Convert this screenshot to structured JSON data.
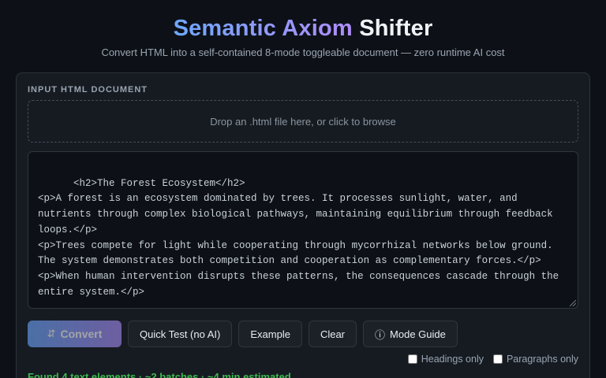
{
  "header": {
    "title_part1": "Semantic Axiom",
    "title_part2": "Shifter",
    "subtitle": "Convert HTML into a self-contained 8-mode toggleable document — zero runtime AI cost"
  },
  "input": {
    "section_label": "INPUT HTML DOCUMENT",
    "dropzone_text": "Drop an .html file here, or click to browse",
    "html_value": "<h2>The Forest Ecosystem</h2>\n<p>A forest is an ecosystem dominated by trees. It processes sunlight, water, and nutrients through complex biological pathways, maintaining equilibrium through feedback loops.</p>\n<p>Trees compete for light while cooperating through mycorrhizal networks below ground. The system demonstrates both competition and cooperation as complementary forces.</p>\n<p>When human intervention disrupts these patterns, the consequences cascade through the entire system.</p>"
  },
  "toolbar": {
    "convert_icon": "⇵",
    "convert_label": "Convert",
    "quick_test_label": "Quick Test (no AI)",
    "example_label": "Example",
    "clear_label": "Clear",
    "guide_icon": "ⓘ",
    "guide_label": "Mode Guide"
  },
  "filters": {
    "headings_label": "Headings only",
    "paragraphs_label": "Paragraphs only"
  },
  "status": {
    "text": "Found 4 text elements · ~2 batches · ~4 min estimated"
  },
  "colors": {
    "background": "#0d1117",
    "card": "#161b22",
    "accent_start": "#6ea8fe",
    "accent_end": "#b08cf9",
    "status_green": "#3fb950"
  }
}
